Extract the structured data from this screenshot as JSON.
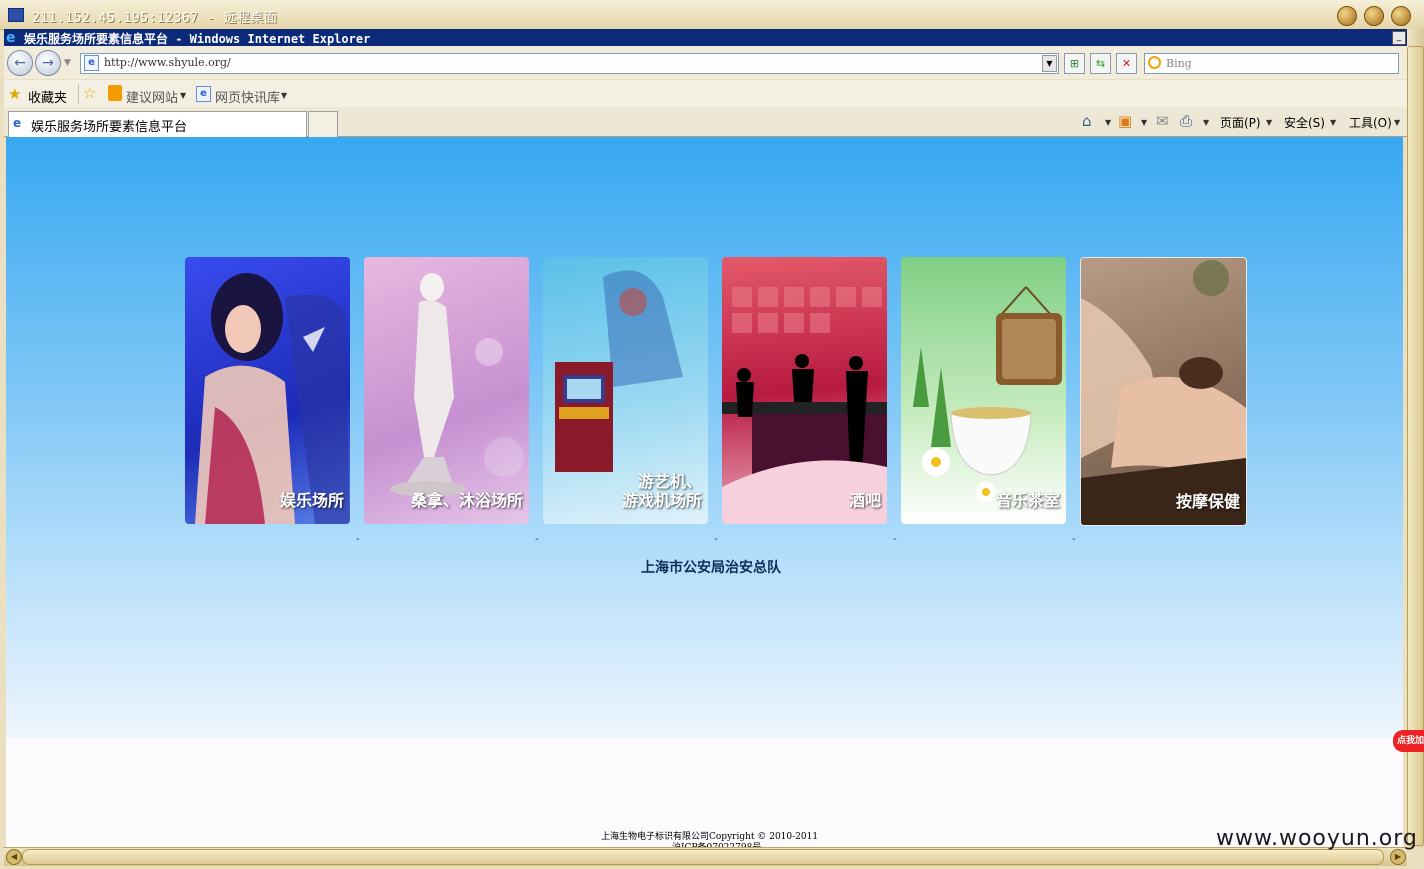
{
  "remote_desktop": {
    "title": "211.152.45.195:12367 - 远程桌面"
  },
  "browser": {
    "window_title": "娱乐服务场所要素信息平台 - Windows Internet Explorer",
    "address_url": "http://www.shyule.org/",
    "search_placeholder": "Bing",
    "favorites_label": "收藏夹",
    "favorites_items": [
      "建议网站",
      "网页快讯库"
    ],
    "tab_title": "娱乐服务场所要素信息平台",
    "commands": [
      "页面(P)",
      "安全(S)",
      "工具(O)"
    ]
  },
  "page": {
    "cards": [
      {
        "label": "娱乐场所",
        "accent": "#2a3fd8"
      },
      {
        "label": "桑拿、沐浴场所",
        "accent": "#c79ad8"
      },
      {
        "label_line1": "游艺机、",
        "label_line2": "游戏机场所",
        "accent": "#6ac6ea"
      },
      {
        "label": "酒吧",
        "accent": "#d8455e"
      },
      {
        "label": "音乐茶室",
        "accent": "#7fcf85"
      },
      {
        "label": "按摩保健",
        "accent": "#8c7562"
      }
    ],
    "footer_title": "上海市公安局治安总队",
    "copyright": "上海生物电子标识有限公司Copyright © 2010-2011",
    "icp": "沪ICP备07022798号"
  },
  "overlay": {
    "badge": "点我加",
    "watermark": "www.wooyun.org"
  }
}
